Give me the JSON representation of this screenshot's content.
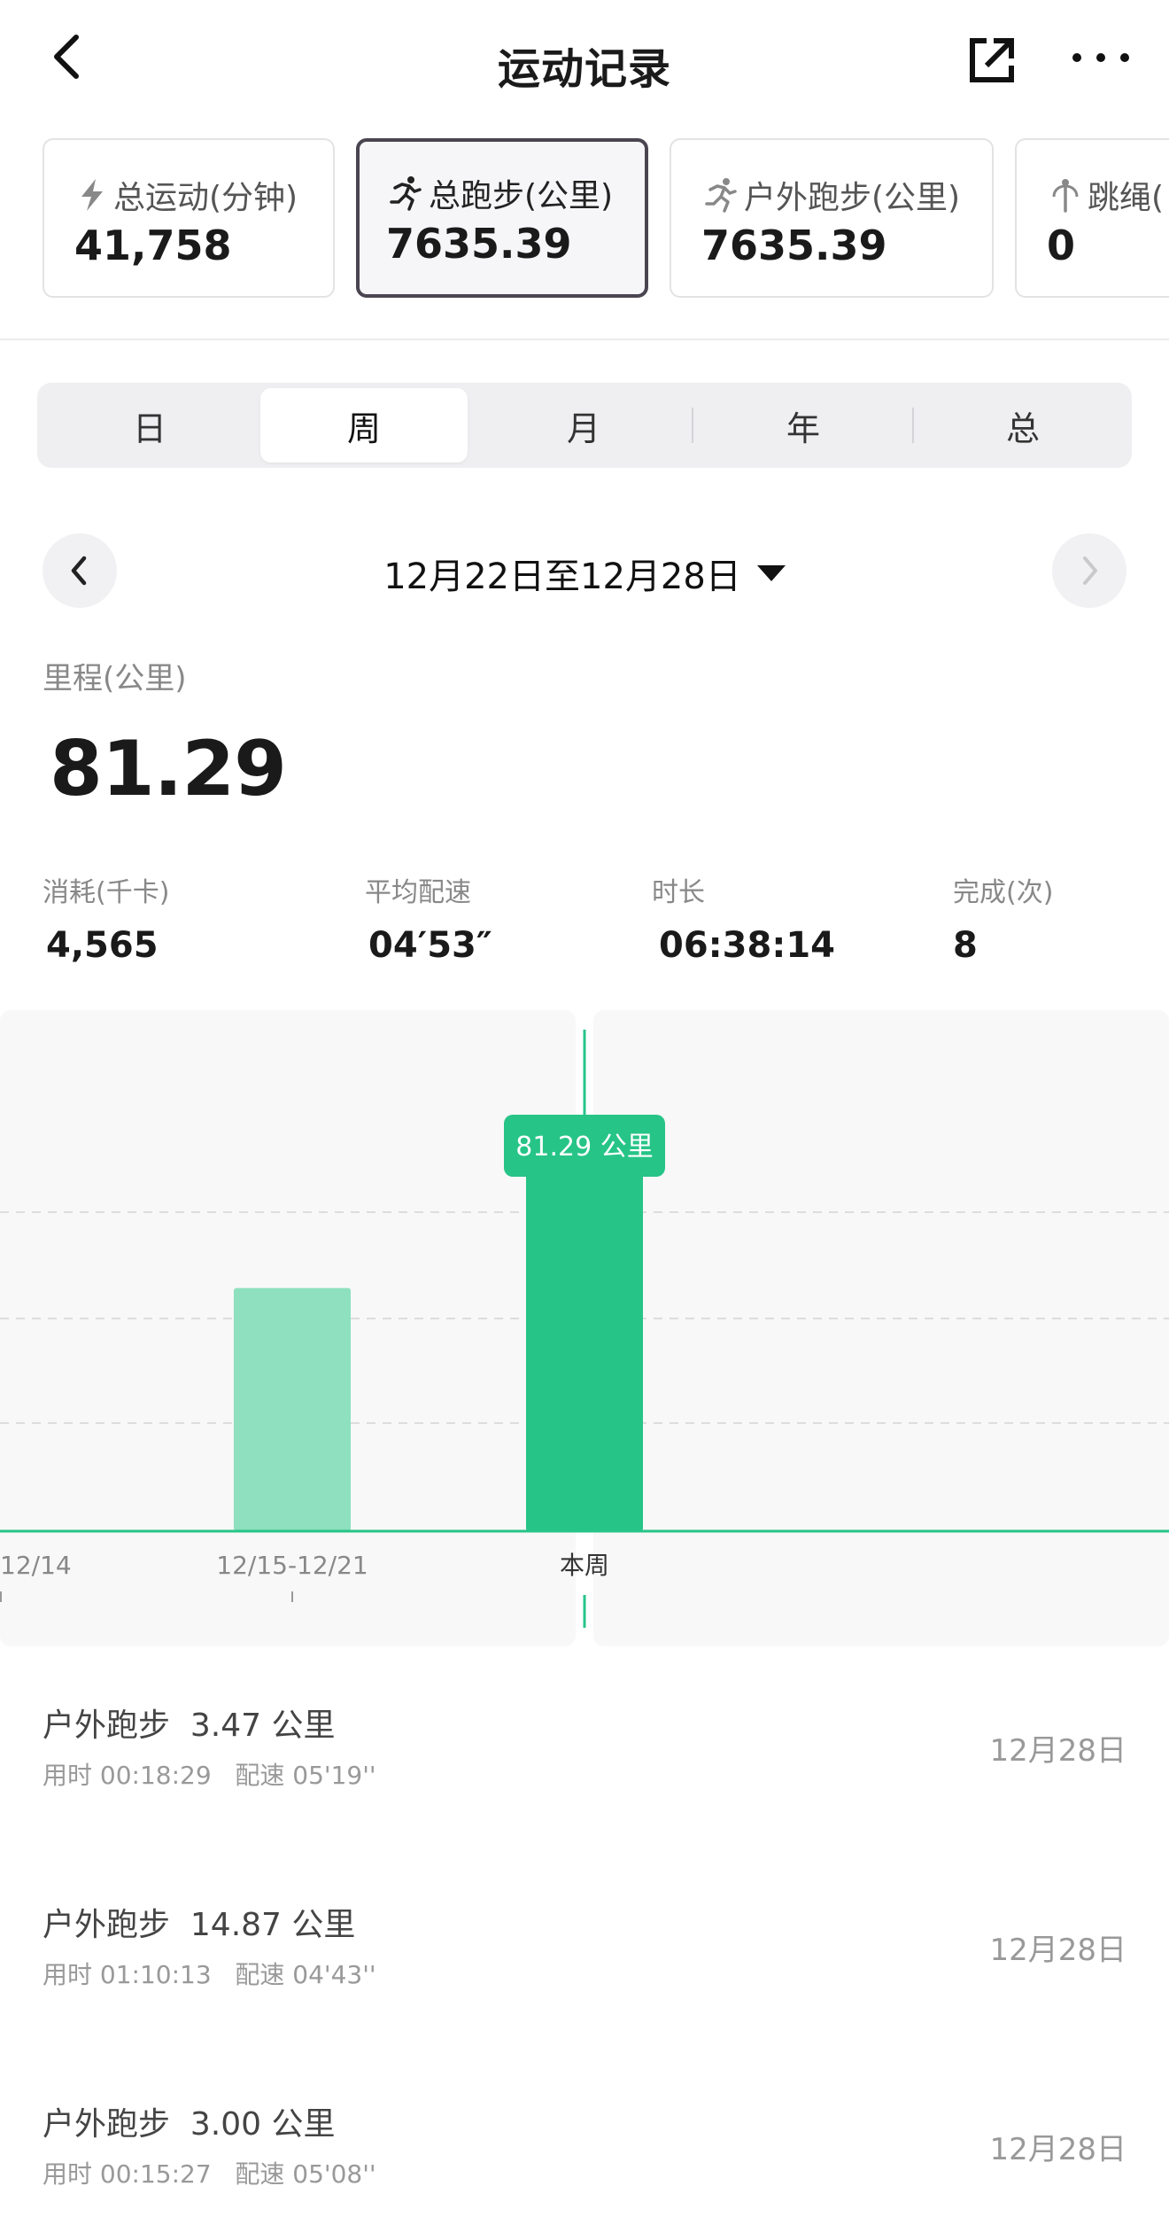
{
  "header": {
    "title": "运动记录",
    "back_icon": "chevron-left-icon",
    "share_icon": "external-share-icon",
    "more_icon": "more-dots-icon"
  },
  "cards": [
    {
      "label": "总运动(分钟)",
      "value": "41,758",
      "icon": "lightning-icon",
      "active": false
    },
    {
      "label": "总跑步(公里)",
      "value": "7635.39",
      "icon": "runner-icon",
      "active": true
    },
    {
      "label": "户外跑步(公里)",
      "value": "7635.39",
      "icon": "runner-icon",
      "active": false
    },
    {
      "label": "跳绳(",
      "value": "0",
      "icon": "jump-rope-icon",
      "active": false
    }
  ],
  "periods": [
    "日",
    "周",
    "月",
    "年",
    "总"
  ],
  "selected_period": "周",
  "date_range": "12月22日至12月28日",
  "distance": {
    "label": "里程(公里)",
    "value": "81.29"
  },
  "metrics": [
    {
      "label": "消耗(千卡)",
      "value": "4,565"
    },
    {
      "label": "平均配速",
      "value": "04′53″"
    },
    {
      "label": "时长",
      "value": "06:38:14"
    },
    {
      "label": "完成(次)",
      "value": "8"
    }
  ],
  "chart_data": {
    "type": "bar",
    "categories": [
      "12/14",
      "12/15-12/21",
      "本周"
    ],
    "values": [
      0,
      54,
      81.29
    ],
    "selected_index": 2,
    "tooltip": "81.29 公里",
    "unit": "公里",
    "grid": true,
    "colors": {
      "selected": "#26C487",
      "other": "#8EE0BE",
      "line": "#26C487",
      "background": "#F8F8F8"
    }
  },
  "runs": [
    {
      "title": "户外跑步  3.47 公里",
      "sub": "用时 00:18:29   配速 05'19''",
      "date": "12月28日"
    },
    {
      "title": "户外跑步  14.87 公里",
      "sub": "用时 01:10:13   配速 04'43''",
      "date": "12月28日"
    },
    {
      "title": "户外跑步  3.00 公里",
      "sub": "用时 00:15:27   配速 05'08''",
      "date": "12月28日"
    }
  ]
}
